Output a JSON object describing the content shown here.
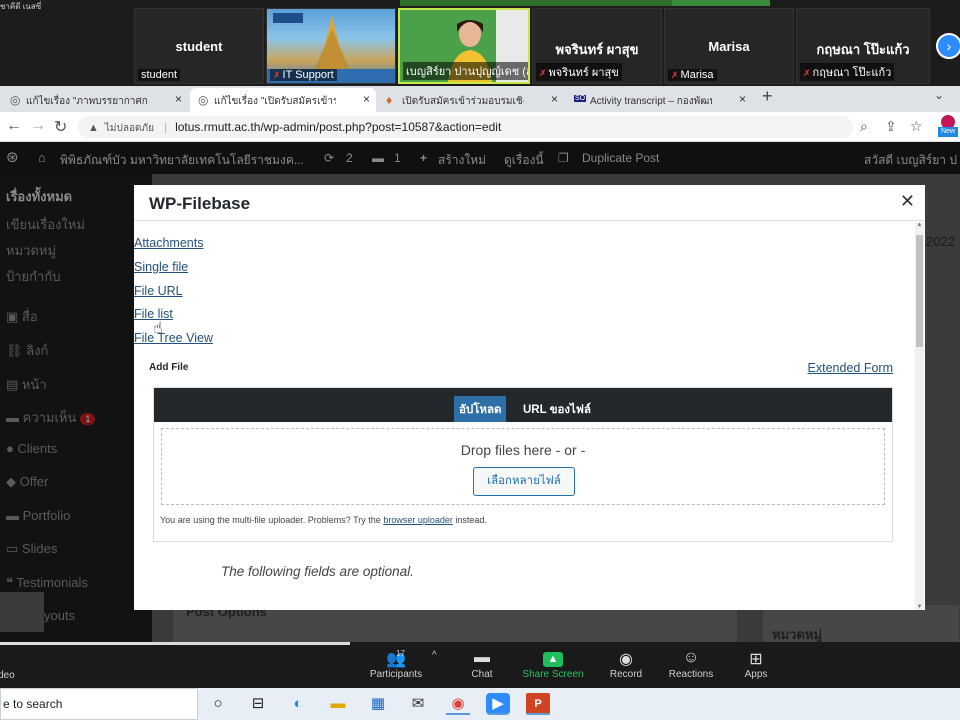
{
  "zoom": {
    "corner_text": "ชาคีดี เนสซี่",
    "participants": [
      {
        "name": "student",
        "label": "student",
        "muted": false,
        "video": false
      },
      {
        "name": "",
        "label": "IT Support",
        "muted": true,
        "video": true
      },
      {
        "name": "",
        "label": "เบญสิร์ยา ปานปุญญ์เดช (สวส)",
        "muted": false,
        "video": true,
        "active": true
      },
      {
        "name": "พจรินทร์ ผาสุข",
        "label": "พจรินทร์ ผาสุข",
        "muted": true,
        "video": false
      },
      {
        "name": "Marisa",
        "label": "Marisa",
        "muted": true,
        "video": false
      },
      {
        "name": "กฤษณา โป๊ะแก้ว",
        "label": "กฤษณา โป๊ะแก้ว",
        "muted": true,
        "video": false
      }
    ],
    "controls": {
      "left_label": "deo",
      "participants_label": "Participants",
      "participants_count": "17",
      "chat_label": "Chat",
      "share_label": "Share Screen",
      "record_label": "Record",
      "reactions_label": "Reactions",
      "apps_label": "Apps"
    }
  },
  "browser": {
    "tabs": [
      {
        "title": "แก้ไขเรื่อง \"ภาพบรรยากาศการอบรมเชิง"
      },
      {
        "title": "แก้ไขเรื่อง \"เปิดรับสมัครเข้าร่วมอบรมเชิ"
      },
      {
        "title": "เปิดรับสมัครเข้าร่วมอบรมเชิงปฏิบัติการ"
      },
      {
        "title": "Activity transcript – กองพัฒนานักศึก"
      }
    ],
    "security_text": "ไม่ปลอดภัย",
    "url": "lotus.rmutt.ac.th/wp-admin/post.php?post=10587&action=edit",
    "new_badge": "New"
  },
  "wp": {
    "adminbar": {
      "site": "พิพิธภัณฑ์บัว มหาวิทยาลัยเทคโนโลยีราชมงค...",
      "updates": "2",
      "comments": "1",
      "new": "สร้างใหม่",
      "view": "ดูเรื่องนี้",
      "duplicate": "Duplicate Post",
      "greeting": "สวัสดี เบญสิร์ยา ป"
    },
    "menu": [
      "เรื่องทั้งหมด",
      "เขียนเรื่องใหม่",
      "หมวดหมู่",
      "ป้ายกำกับ",
      "สื่อ",
      "ลิงก์",
      "หน้า",
      "ความเห็น",
      "Clients",
      "Offer",
      "Portfolio",
      "Slides",
      "Testimonials",
      "youts"
    ],
    "comments_badge": "1",
    "post_options": "Post Options",
    "categories": "หมวดหมู่",
    "year_fragment": "2022"
  },
  "modal": {
    "title": "WP-Filebase",
    "links": [
      "Attachments",
      "Single file",
      "File URL",
      "File list",
      "File Tree View"
    ],
    "add_file": "Add File",
    "extended_form": "Extended Form",
    "upload_tab": "อัปโหลด",
    "url_tab": "URL ของไฟล์",
    "drop_text": "Drop files here - or -",
    "select_button": "เลือกหลายไฟล์",
    "note_prefix": "You are using the multi-file uploader. Problems? Try the",
    "note_link": "browser uploader",
    "note_suffix": "instead.",
    "optional": "The following fields are optional."
  },
  "taskbar": {
    "search_text": "e to search"
  }
}
